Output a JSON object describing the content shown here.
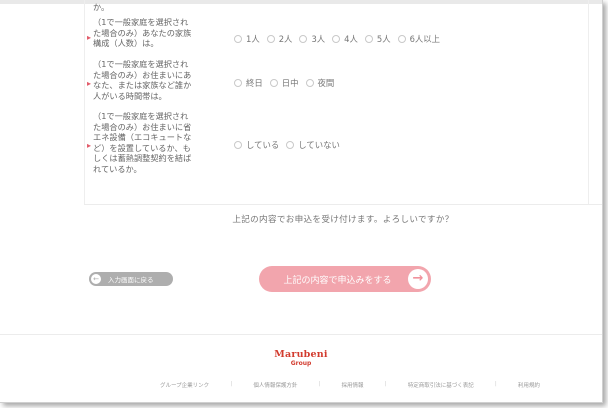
{
  "questions": [
    {
      "text_lines": [
        "か。"
      ],
      "options": []
    },
    {
      "text_lines": [
        "（1で一般家庭を選択され",
        "た場合のみ）あなたの家族",
        "構成（人数）は。"
      ],
      "options": [
        "1人",
        "2人",
        "3人",
        "4人",
        "5人",
        "6人以上"
      ]
    },
    {
      "text_lines": [
        "（1で一般家庭を選択され",
        "た場合のみ）お住まいにあ",
        "なた、または家族など誰か",
        "人がいる時間帯は。"
      ],
      "options": [
        "終日",
        "日中",
        "夜間"
      ]
    },
    {
      "text_lines": [
        "（1で一般家庭を選択され",
        "た場合のみ）お住まいに省",
        "エネ設備（エコキュートな",
        "ど）を設置しているか、も",
        "しくは蓄熱調整契約を結ば",
        "れているか。"
      ],
      "options": [
        "している",
        "していない"
      ]
    }
  ],
  "confirm_text": "上記の内容でお申込を受け付けます。よろしいですか？",
  "back_button": {
    "label": "入力画面に戻る",
    "icon": "arrow-left-icon"
  },
  "submit_button": {
    "label": "上記の内容で申込みをする",
    "icon": "arrow-right-icon"
  },
  "logo": {
    "name": "Marubeni",
    "group": "Group",
    "color": "#d23b2e"
  },
  "footer_links": [
    "グループ企業リンク",
    "個人情報保護方針",
    "採用情報",
    "特定商取引法に基づく表記",
    "利用規約"
  ],
  "colors": {
    "accent": "#f2a5ad",
    "required": "#e25a69",
    "back_button": "#aeaeae"
  }
}
